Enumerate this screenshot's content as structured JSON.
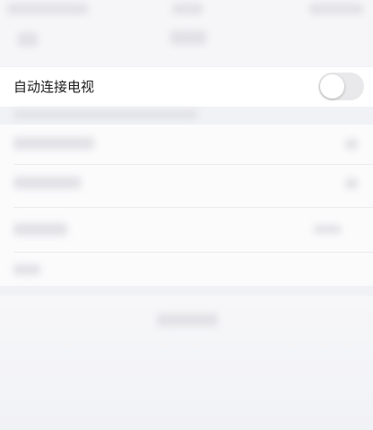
{
  "auto_connect_tv": {
    "label": "自动连接电视",
    "toggle_on": false
  },
  "colors": {
    "toggle_off_track": "#e9e9eb",
    "row_background": "#ffffff",
    "page_background": "#f1f2f6"
  }
}
